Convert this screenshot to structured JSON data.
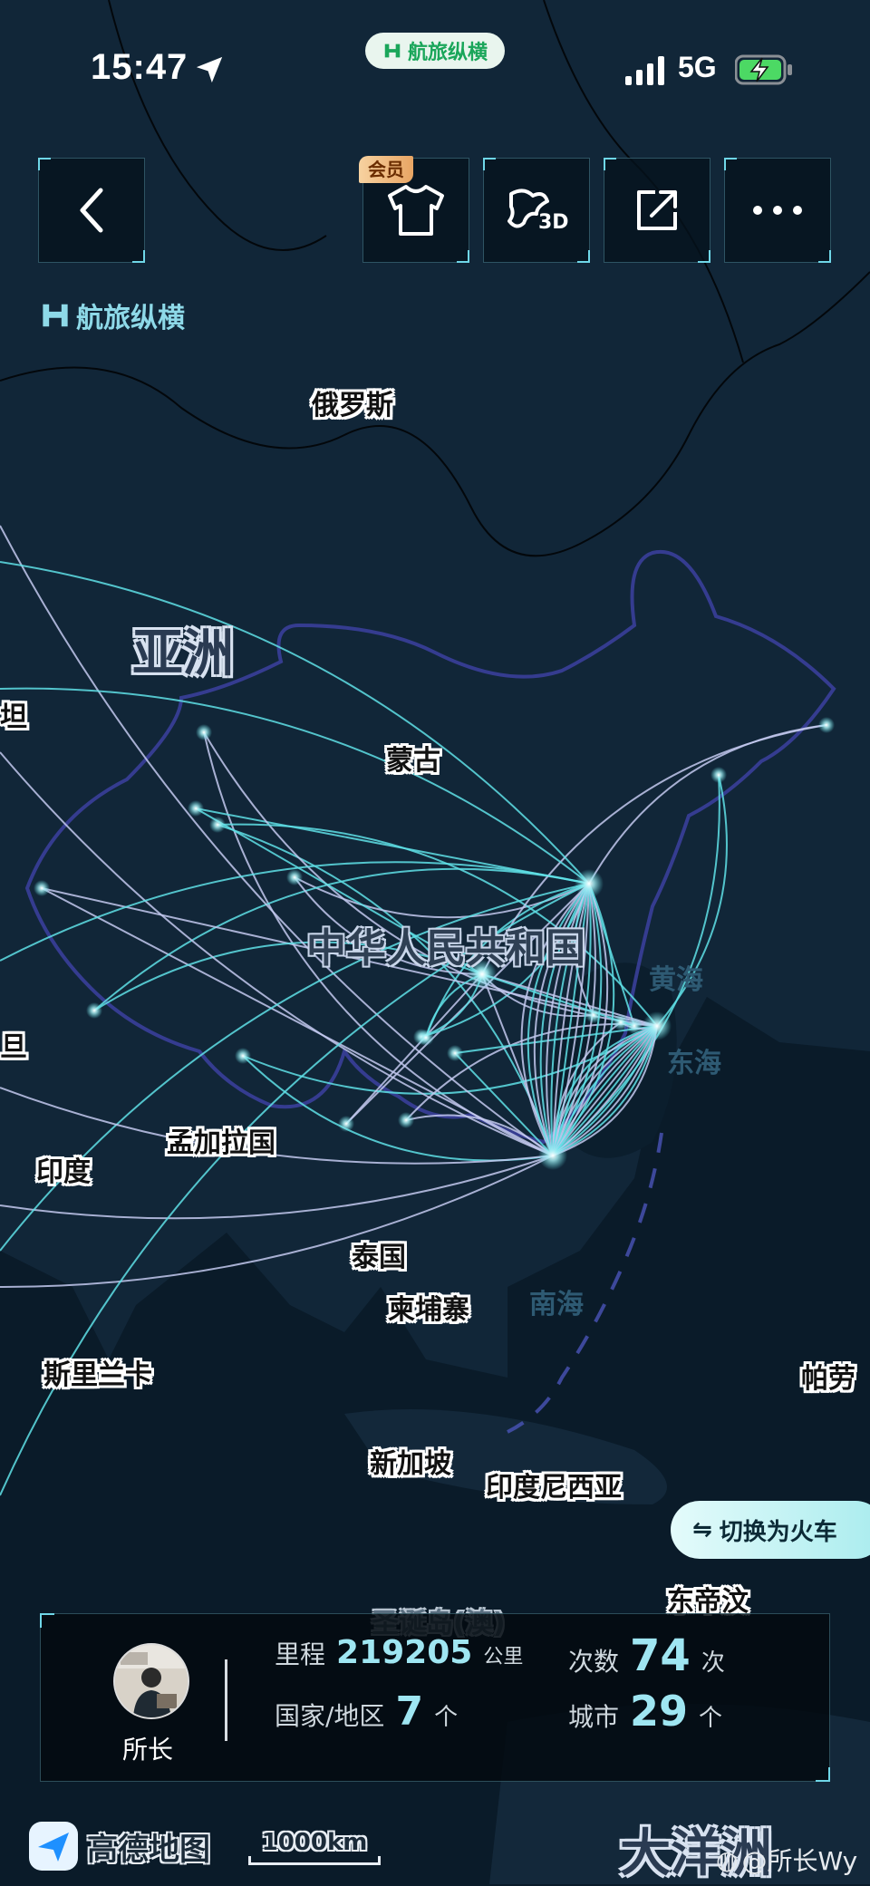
{
  "status_bar": {
    "time": "15:47",
    "network": "5G",
    "app_pill_label": "航旅纵横"
  },
  "top_buttons": {
    "back": "back",
    "member_badge": "会员",
    "skin_icon": "tshirt-icon",
    "view3d_label": "3D",
    "share_icon": "share-icon",
    "more_icon": "more-icon"
  },
  "brand": {
    "label": "航旅纵横"
  },
  "map_labels": {
    "russia": "俄罗斯",
    "asia": "亚洲",
    "stan": "坦",
    "mongolia": "蒙古",
    "china": "中华人民共和国",
    "yellow_sea": "黄海",
    "east_sea": "东海",
    "left_edge": "旦",
    "bangladesh": "孟加拉国",
    "india": "印度",
    "thailand": "泰国",
    "cambodia": "柬埔寨",
    "south_sea": "南海",
    "sri_lanka": "斯里兰卡",
    "palau": "帕劳",
    "singapore": "新加坡",
    "indonesia": "印度尼西亚",
    "timor": "东帝汶",
    "christmas": "圣诞岛(澳)",
    "oceania": "大洋洲"
  },
  "switch_button": {
    "icon": "swap-icon",
    "label": "切换为火车"
  },
  "stats": {
    "user_name": "所长",
    "mileage_label": "里程",
    "mileage_value": "219205",
    "mileage_unit": "公里",
    "trips_label": "次数",
    "trips_value": "74",
    "trips_unit": "次",
    "countries_label": "国家/地区",
    "countries_value": "7",
    "countries_unit": "个",
    "cities_label": "城市",
    "cities_value": "29",
    "cities_unit": "个"
  },
  "footer": {
    "map_provider": "高德地图",
    "scale_label": "1000km",
    "watermark": "@所长Wy"
  },
  "colors": {
    "route_cyan": "#5fe0e6",
    "route_lavender": "#c3c9ee",
    "accent": "#9fe6f2",
    "background": "#0a1b29"
  }
}
